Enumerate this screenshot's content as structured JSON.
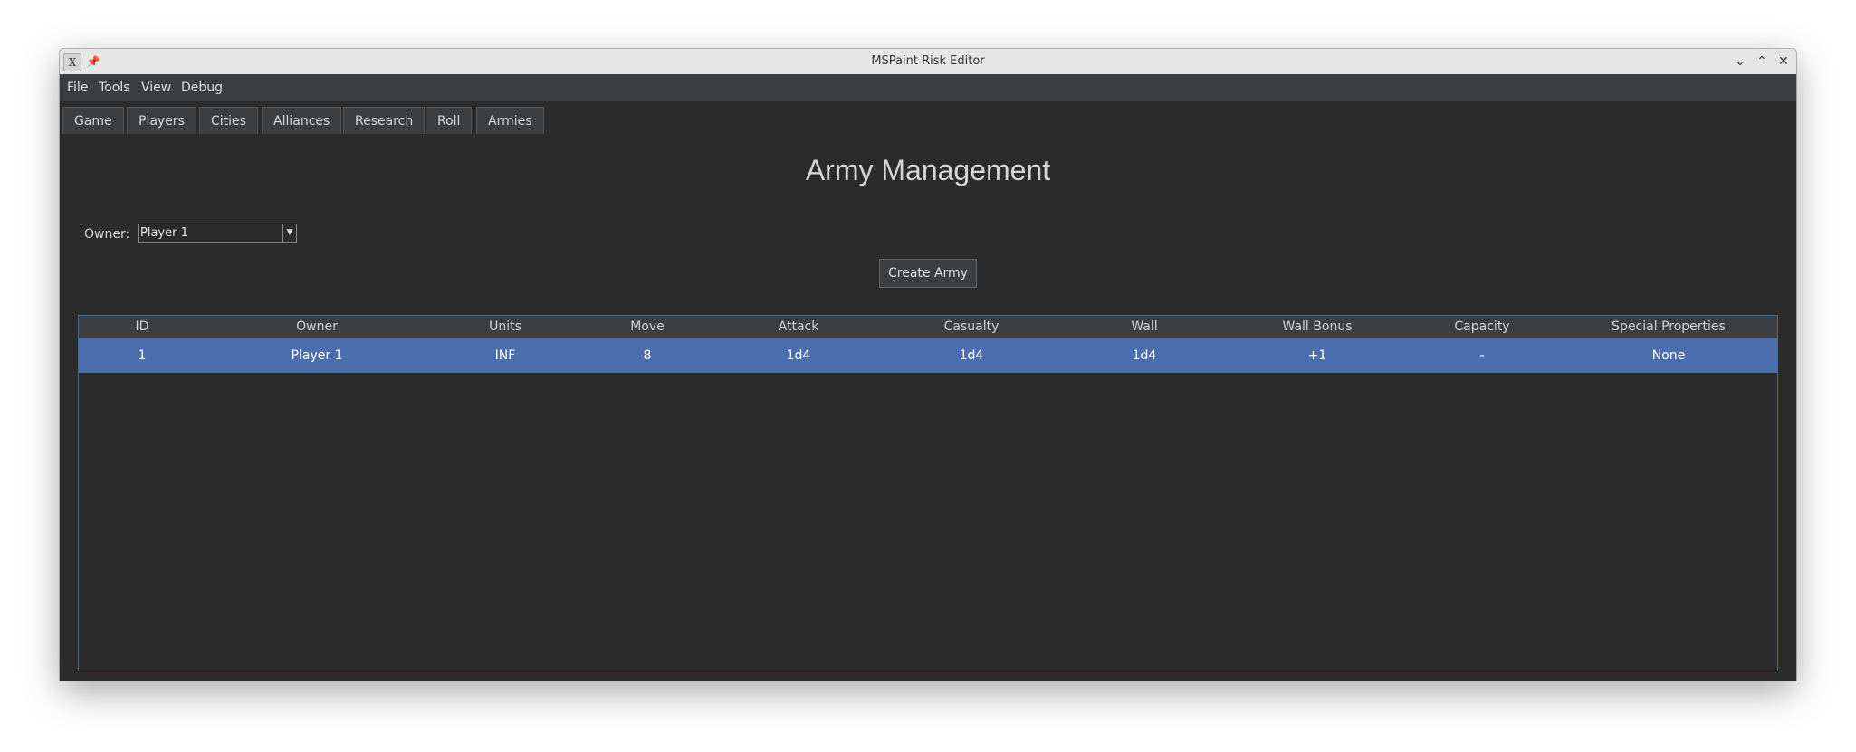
{
  "window": {
    "title": "MSPaint Risk Editor",
    "app_icon_glyph": "X",
    "pin_glyph": "📌",
    "controls": {
      "minimize": "⌄",
      "maximize": "⌃",
      "close": "✕"
    }
  },
  "menubar": {
    "items": [
      "File",
      "Tools",
      "View",
      "Debug"
    ]
  },
  "tabs": [
    "Game",
    "Players",
    "Cities",
    "Alliances",
    "Research",
    "Roll",
    "Armies"
  ],
  "main": {
    "title": "Army Management",
    "owner_label": "Owner:",
    "owner_selected": "Player 1",
    "create_button": "Create Army"
  },
  "table": {
    "columns": [
      "ID",
      "Owner",
      "Units",
      "Move",
      "Attack",
      "Casualty",
      "Wall",
      "Wall Bonus",
      "Capacity",
      "Special Properties"
    ],
    "rows": [
      [
        "1",
        "Player 1",
        "INF",
        "8",
        "1d4",
        "1d4",
        "1d4",
        "+1",
        "-",
        "None"
      ]
    ],
    "selected_row": 0
  },
  "colors": {
    "background": "#2b2b2b",
    "menubar": "#3c3f41",
    "selection": "#4b6eaf",
    "table_border": "#4a6b8e"
  }
}
